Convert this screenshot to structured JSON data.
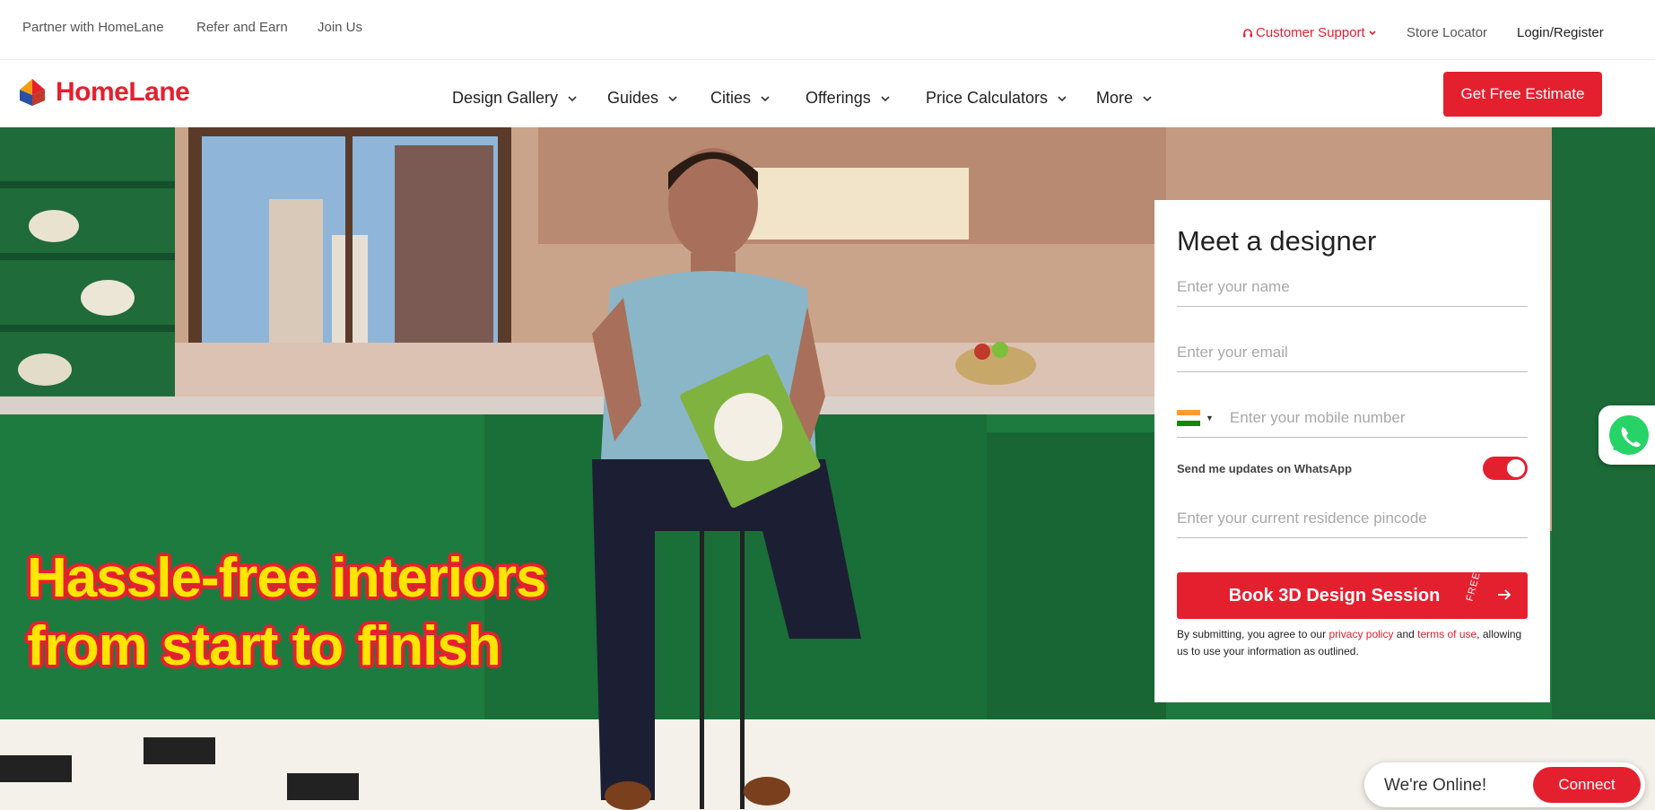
{
  "topbar": {
    "partner": "Partner with HomeLane",
    "refer": "Refer and Earn",
    "join": "Join Us",
    "support": "Customer Support",
    "store": "Store Locator",
    "login": "Login/Register"
  },
  "brand": {
    "name": "HomeLane",
    "accent": "#e4202f"
  },
  "nav": {
    "items": [
      "Design Gallery",
      "Guides",
      "Cities",
      "Offerings",
      "Price Calculators",
      "More"
    ],
    "estimate": "Get Free Estimate"
  },
  "hero": {
    "headline_line1": "Hassle-free interiors",
    "headline_line2": "from start to finish"
  },
  "form": {
    "title": "Meet a designer",
    "name_placeholder": "Enter your name",
    "email_placeholder": "Enter your email",
    "mobile_placeholder": "Enter your mobile number",
    "whatsapp_label": "Send me updates on WhatsApp",
    "whatsapp_enabled": true,
    "pincode_placeholder": "Enter your current residence pincode",
    "book_label": "Book 3D Design Session",
    "free_tag": "FREE",
    "disclaimer_pre": "By submitting, you agree to our ",
    "privacy_link": "privacy policy",
    "disclaimer_and": " and ",
    "terms_link": "terms of use",
    "disclaimer_post": ", allowing us to use your information as outlined."
  },
  "chat": {
    "status": "We're Online!",
    "connect": "Connect"
  }
}
